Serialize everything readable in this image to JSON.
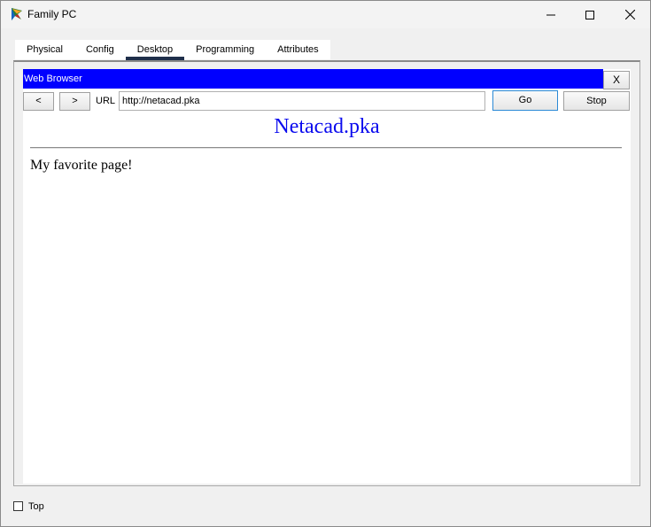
{
  "window": {
    "title": "Family PC",
    "icon": "cisco-packet-tracer-pc-icon",
    "controls": [
      "minimize-icon",
      "maximize-icon",
      "close-icon"
    ]
  },
  "tabs": [
    {
      "label": "Physical",
      "active": false
    },
    {
      "label": "Config",
      "active": false
    },
    {
      "label": "Desktop",
      "active": true
    },
    {
      "label": "Programming",
      "active": false
    },
    {
      "label": "Attributes",
      "active": false
    }
  ],
  "browser": {
    "title": "Web Browser",
    "close_label": "X",
    "back_label": "<",
    "forward_label": ">",
    "url_label": "URL",
    "url_value": "http://netacad.pka",
    "go_label": "Go",
    "stop_label": "Stop",
    "title_bar_color": "#0000ff"
  },
  "page": {
    "heading": "Netacad.pka",
    "heading_color": "#0a0aee",
    "body_text": "My favorite page!"
  },
  "footer": {
    "top_label": "Top",
    "top_checked": false
  }
}
